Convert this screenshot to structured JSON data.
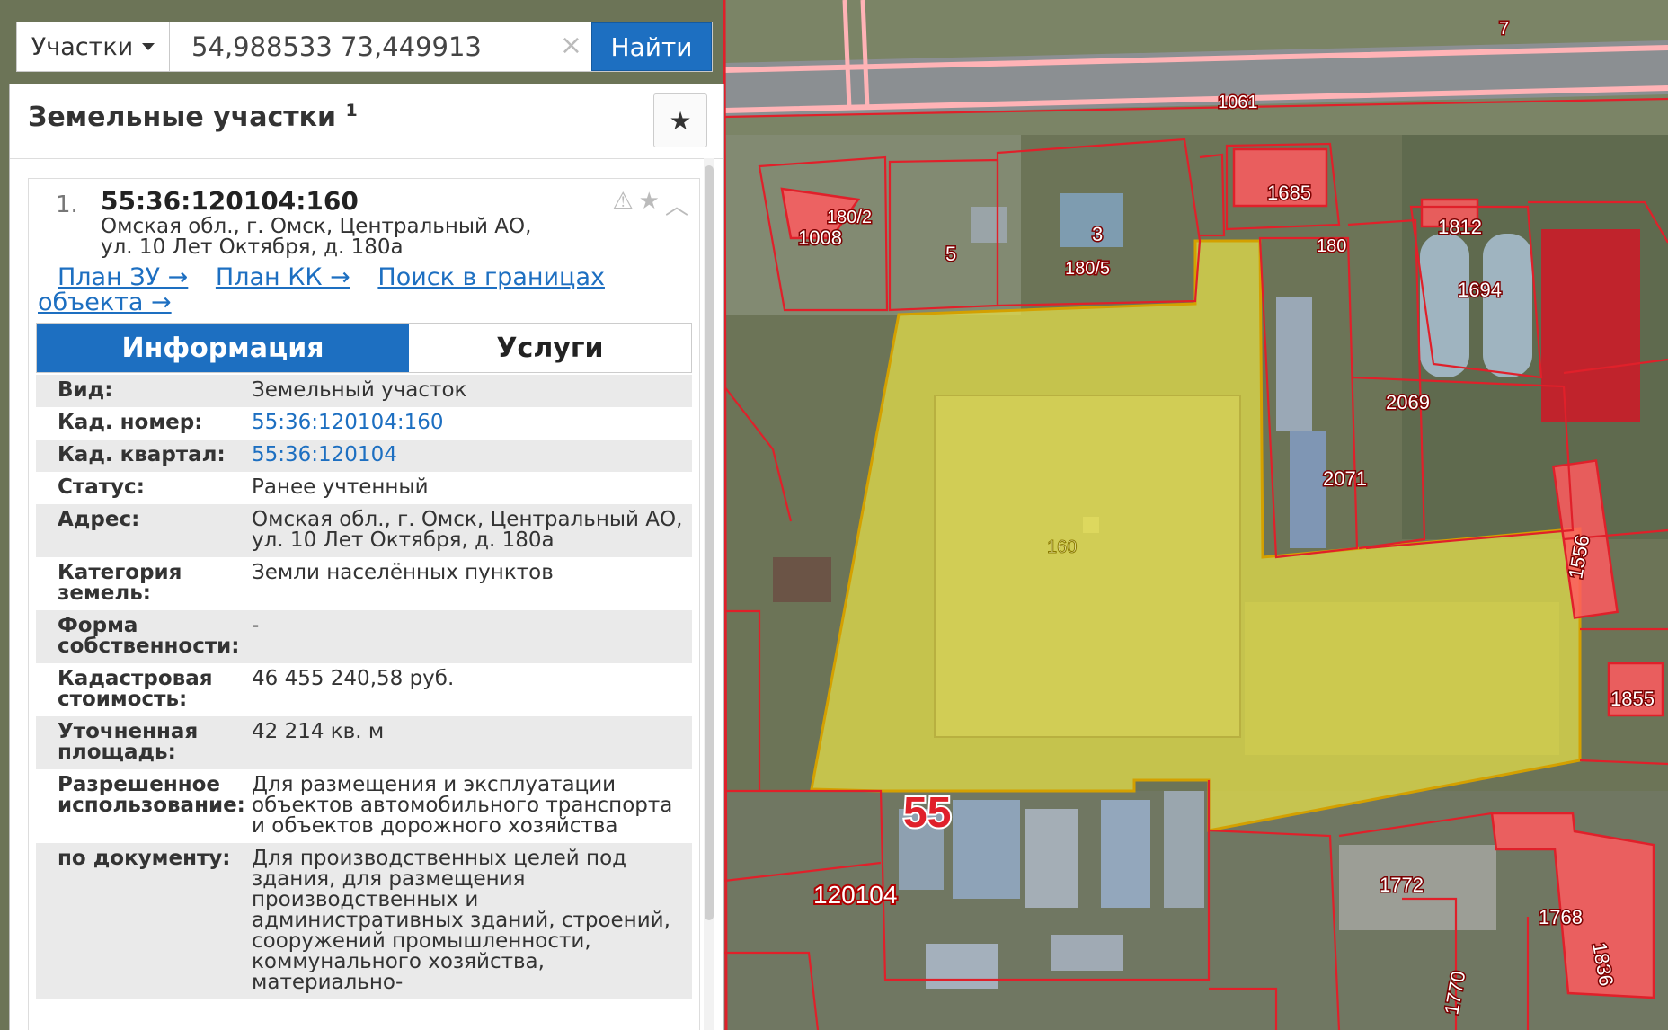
{
  "search": {
    "type_label": "Участки",
    "query": "54,988533 73,449913",
    "clear_glyph": "×",
    "find_label": "Найти"
  },
  "results": {
    "title": "Земельные участки",
    "count": "1",
    "favorite_glyph": "★"
  },
  "item": {
    "index": "1.",
    "cad_number": "55:36:120104:160",
    "address": "Омская обл., г. Омск, Центральный АО, ул. 10 Лет Октября, д. 180а",
    "links": {
      "plan_zu": "План ЗУ →",
      "plan_kk": "План КК →",
      "search_bounds": "Поиск в границах объекта →"
    },
    "tabs": {
      "info": "Информация",
      "services": "Услуги"
    },
    "attributes": [
      {
        "key": "Вид:",
        "value": "Земельный участок"
      },
      {
        "key": "Кад. номер:",
        "value": "55:36:120104:160"
      },
      {
        "key": "Кад. квартал:",
        "value": "55:36:120104"
      },
      {
        "key": "Статус:",
        "value": "Ранее учтенный"
      },
      {
        "key": "Адрес:",
        "value": "Омская обл., г. Омск, Центральный АО, ул. 10 Лет Октября, д. 180а"
      },
      {
        "key": "Категория земель:",
        "value": "Земли населённых пунктов"
      },
      {
        "key": "Форма собственности:",
        "value": "-"
      },
      {
        "key": "Кадастровая стоимость:",
        "value": "46 455 240,58 руб."
      },
      {
        "key": "Уточненная площадь:",
        "value": "42 214 кв. м"
      },
      {
        "key": "Разрешенное использование:",
        "value": "Для размещения и эксплуатации объектов автомобильного транспорта и объектов дорожного хозяйства"
      },
      {
        "key": "по документу:",
        "value": "Для производственных целей под здания, для размещения производственных и административных зданий, строений, сооружений промышленности, коммунального хозяйства, материально-"
      }
    ]
  },
  "map": {
    "labels": {
      "road": "7",
      "p1061": "1061",
      "p1685": "1685",
      "p1812": "1812",
      "p1008": "1008",
      "p180_2": "180/2",
      "p5": "5",
      "p3": "3",
      "p180_5": "180/5",
      "p180": "180",
      "p1694": "1694",
      "p2069": "2069",
      "p2071": "2071",
      "p160": "160",
      "p1556": "1556",
      "p1855": "1855",
      "district": "55",
      "quarter": "120104",
      "p1772": "1772",
      "p1768": "1768",
      "p1836": "1836",
      "p1770": "1770"
    },
    "colors": {
      "parcel_border": "#e0202a",
      "parcel_fill": "#ff5a5f",
      "selected_fill": "#e8e24a",
      "selected_border": "#d4a000"
    }
  }
}
